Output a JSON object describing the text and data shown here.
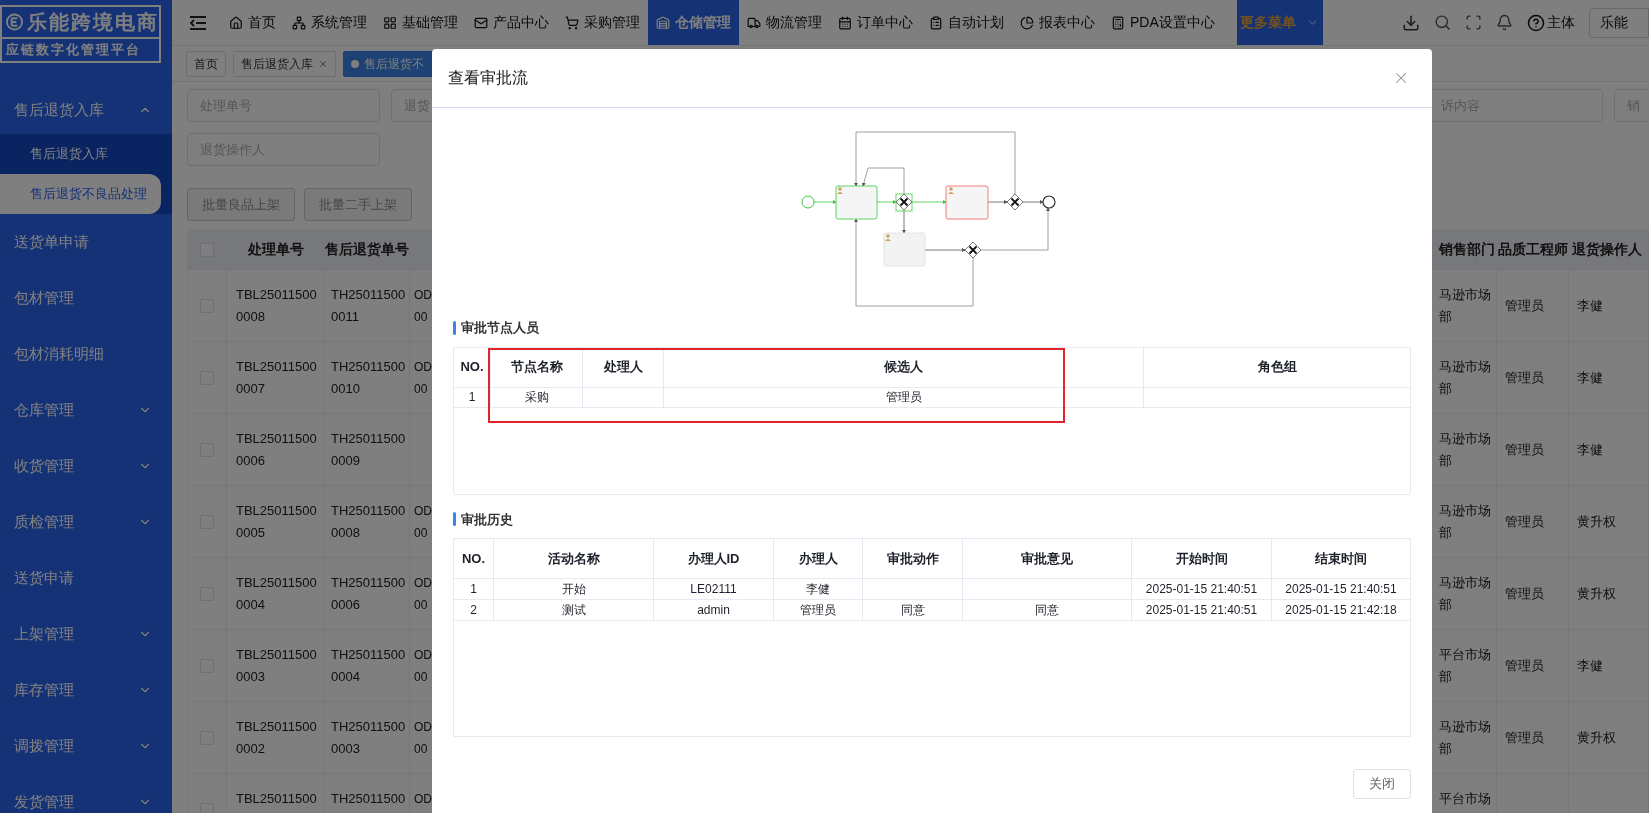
{
  "sidebar": {
    "logo": {
      "title": "乐能跨境电商",
      "subtitle": "应链数字化管理平台"
    },
    "items": [
      {
        "label": "售后退货入库",
        "kind": "group",
        "expanded": true,
        "children": [
          {
            "label": "售后退货入库",
            "selected": false
          },
          {
            "label": "售后退货不良品处理",
            "selected": true
          }
        ]
      },
      {
        "label": "送货单申请",
        "kind": "link"
      },
      {
        "label": "包材管理",
        "kind": "link"
      },
      {
        "label": "包材消耗明细",
        "kind": "link"
      },
      {
        "label": "仓库管理",
        "kind": "group",
        "expanded": false
      },
      {
        "label": "收货管理",
        "kind": "group",
        "expanded": false
      },
      {
        "label": "质检管理",
        "kind": "group",
        "expanded": false
      },
      {
        "label": "送货申请",
        "kind": "link"
      },
      {
        "label": "上架管理",
        "kind": "group",
        "expanded": false
      },
      {
        "label": "库存管理",
        "kind": "group",
        "expanded": false
      },
      {
        "label": "调拨管理",
        "kind": "group",
        "expanded": false
      },
      {
        "label": "发货管理",
        "kind": "group",
        "expanded": false
      }
    ]
  },
  "top_nav": {
    "items": [
      {
        "label": "首页",
        "selected": false
      },
      {
        "label": "系统管理",
        "selected": false
      },
      {
        "label": "基础管理",
        "selected": false
      },
      {
        "label": "产品中心",
        "selected": false
      },
      {
        "label": "采购管理",
        "selected": false
      },
      {
        "label": "仓储管理",
        "selected": true
      },
      {
        "label": "物流管理",
        "selected": false
      },
      {
        "label": "订单中心",
        "selected": false
      },
      {
        "label": "自动计划",
        "selected": false
      },
      {
        "label": "报表中心",
        "selected": false
      },
      {
        "label": "PDA设置中心",
        "selected": false
      }
    ],
    "more_menu": "更多菜单",
    "entity_label": "主体",
    "org_button": "乐能"
  },
  "tabs": [
    {
      "label": "首页",
      "selected": false,
      "closable": false
    },
    {
      "label": "售后退货入库",
      "selected": false,
      "closable": true
    },
    {
      "label": "售后退货不",
      "selected": true,
      "closable": false
    }
  ],
  "filters": {
    "row_1_left": [
      {
        "placeholder": "处理单号"
      },
      {
        "placeholder": "退货"
      }
    ],
    "row_1_right": [
      {
        "placeholder": "诉内容"
      },
      {
        "placeholder": "销"
      }
    ],
    "row_2": [
      {
        "placeholder": "退货操作人"
      }
    ]
  },
  "actions": [
    {
      "label": "批量良品上架"
    },
    {
      "label": "批量二手上架"
    }
  ],
  "table": {
    "columns": {
      "processing_no": "处理单号",
      "return_no": "售后退货单号",
      "sales_dept": "销售部门",
      "quality_engineer": "品质工程师",
      "return_operator": "退货操作人"
    },
    "header_checked": false,
    "rows": [
      {
        "checked": false,
        "processing_no": "TBL250115000008",
        "return_no": "TH250115000011",
        "column_3": [
          "OD",
          "00"
        ],
        "sales_dept": "马逊市场部",
        "quality_engineer": "管理员",
        "return_operator": "李健"
      },
      {
        "checked": false,
        "processing_no": "TBL250115000007",
        "return_no": "TH250115000010",
        "column_3": [
          "OD",
          "00"
        ],
        "sales_dept": "马逊市场部",
        "quality_engineer": "管理员",
        "return_operator": "李健"
      },
      {
        "checked": false,
        "processing_no": "TBL250115000006",
        "return_no": "TH250115000009",
        "sales_dept": "马逊市场部",
        "quality_engineer": "管理员",
        "return_operator": "李健"
      },
      {
        "checked": false,
        "processing_no": "TBL250115000005",
        "return_no": "TH250115000008",
        "column_3": [
          "OD",
          "00"
        ],
        "sales_dept": "马逊市场部",
        "quality_engineer": "管理员",
        "return_operator": "黄升权"
      },
      {
        "checked": false,
        "processing_no": "TBL250115000004",
        "return_no": "TH250115000006",
        "column_3": [
          "OD",
          "00"
        ],
        "sales_dept": "马逊市场部",
        "quality_engineer": "管理员",
        "return_operator": "黄升权"
      },
      {
        "checked": false,
        "processing_no": "TBL250115000003",
        "return_no": "TH250115000004",
        "column_3": [
          "OD",
          "00"
        ],
        "sales_dept": "平台市场部",
        "quality_engineer": "管理员",
        "return_operator": "李健"
      },
      {
        "checked": false,
        "processing_no": "TBL250115000002",
        "return_no": "TH250115000003",
        "column_3": [
          "OD",
          "00"
        ],
        "sales_dept": "马逊市场部",
        "quality_engineer": "管理员",
        "return_operator": "黄升权"
      },
      {
        "checked": false,
        "processing_no": "TBL25011500",
        "return_no": "TH25011500",
        "column_3": [
          "OD"
        ],
        "sales_dept": "平台市场"
      }
    ]
  },
  "modal": {
    "title": "查看审批流",
    "node_section": {
      "title": "审批节点人员",
      "columns": [
        "NO.",
        "节点名称",
        "处理人",
        "候选人",
        "角色组"
      ],
      "rows": [
        {
          "no": "1",
          "node_name": "采购",
          "candidates": "管理员"
        }
      ]
    },
    "history_section": {
      "title": "审批历史",
      "columns": [
        "NO.",
        "活动名称",
        "办理人ID",
        "办理人",
        "审批动作",
        "审批意见",
        "开始时间",
        "结束时间"
      ],
      "rows": [
        {
          "no": "1",
          "activity": "开始",
          "handler_id": "LE02111",
          "handler": "李健",
          "start_time": "2025-01-15 21:40:51",
          "end_time": "2025-01-15 21:40:51"
        },
        {
          "no": "2",
          "activity": "测试",
          "handler_id": "admin",
          "handler": "管理员",
          "action": "同意",
          "comment": "同意",
          "start_time": "2025-01-15 21:40:51",
          "end_time": "2025-01-15 21:42:18"
        }
      ]
    },
    "close_button": "关闭"
  }
}
